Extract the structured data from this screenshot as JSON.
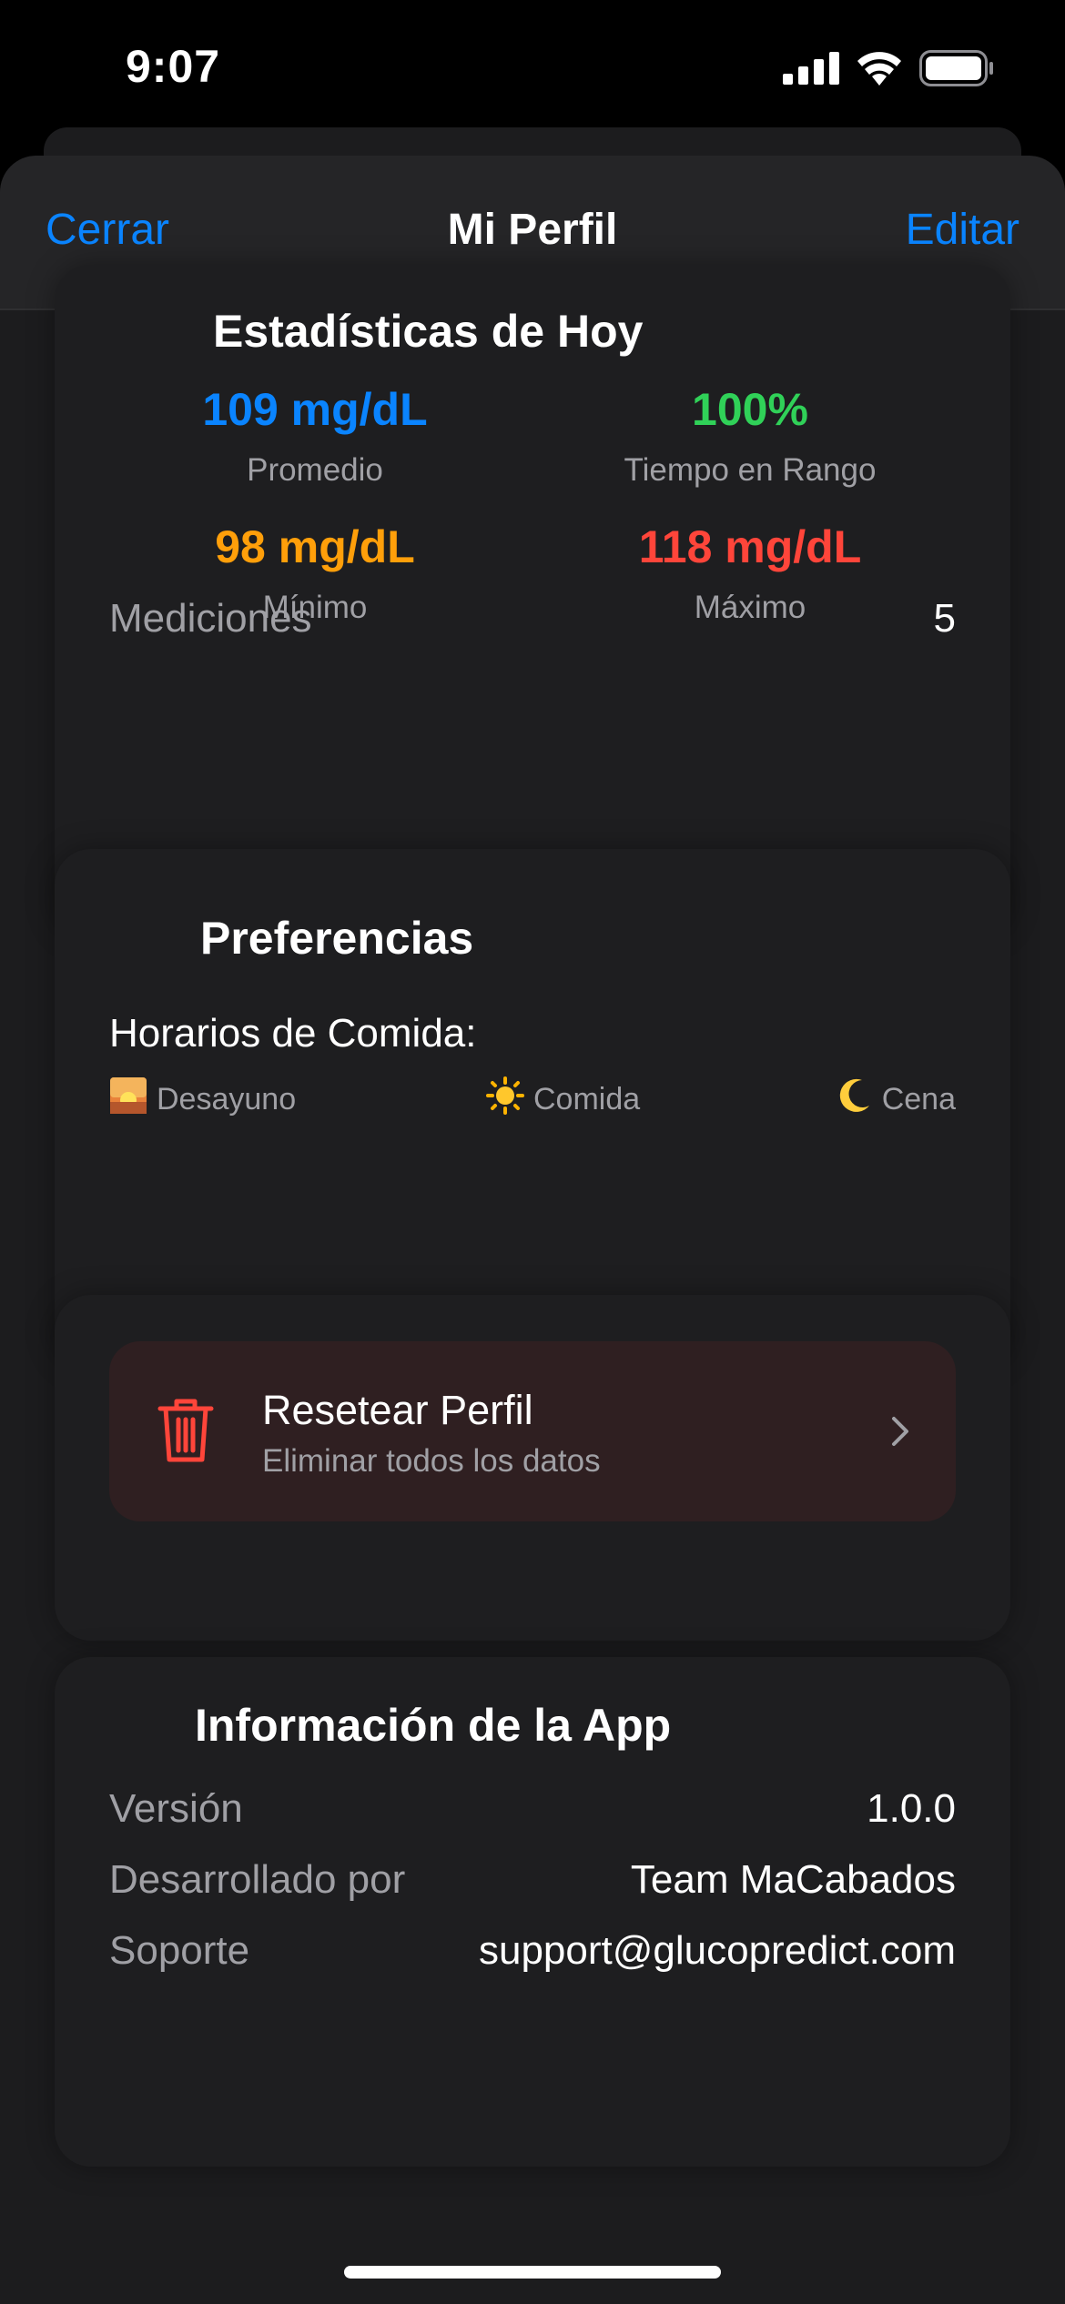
{
  "status": {
    "time": "9:07"
  },
  "nav": {
    "close": "Cerrar",
    "title": "Mi Perfil",
    "edit": "Editar"
  },
  "stats": {
    "title": "Estadísticas de Hoy",
    "average": {
      "value": "109 mg/dL",
      "label": "Promedio"
    },
    "in_range": {
      "value": "100%",
      "label": "Tiempo en Rango"
    },
    "minimum": {
      "value": "98 mg/dL",
      "label": "Mínimo"
    },
    "maximum": {
      "value": "118 mg/dL",
      "label": "Máximo"
    },
    "measurements": {
      "label": "Mediciones",
      "value": "5"
    }
  },
  "preferences": {
    "title": "Preferencias",
    "meal_times_label": "Horarios de Comida:",
    "meals": [
      {
        "label": "Desayuno",
        "icon": "sunrise-icon"
      },
      {
        "label": "Comida",
        "icon": "sun-icon"
      },
      {
        "label": "Cena",
        "icon": "moon-icon"
      }
    ]
  },
  "reset": {
    "title": "Resetear Perfil",
    "subtitle": "Eliminar todos los datos"
  },
  "app_info": {
    "title": "Información de la App",
    "rows": [
      {
        "label": "Versión",
        "value": "1.0.0"
      },
      {
        "label": "Desarrollado por",
        "value": "Team MaCabados"
      },
      {
        "label": "Soporte",
        "value": "support@glucopredict.com"
      }
    ]
  },
  "colors": {
    "accent": "#0a84ff",
    "in_range": "#30d158",
    "minimum": "#ff9f0a",
    "maximum": "#ff453a"
  }
}
